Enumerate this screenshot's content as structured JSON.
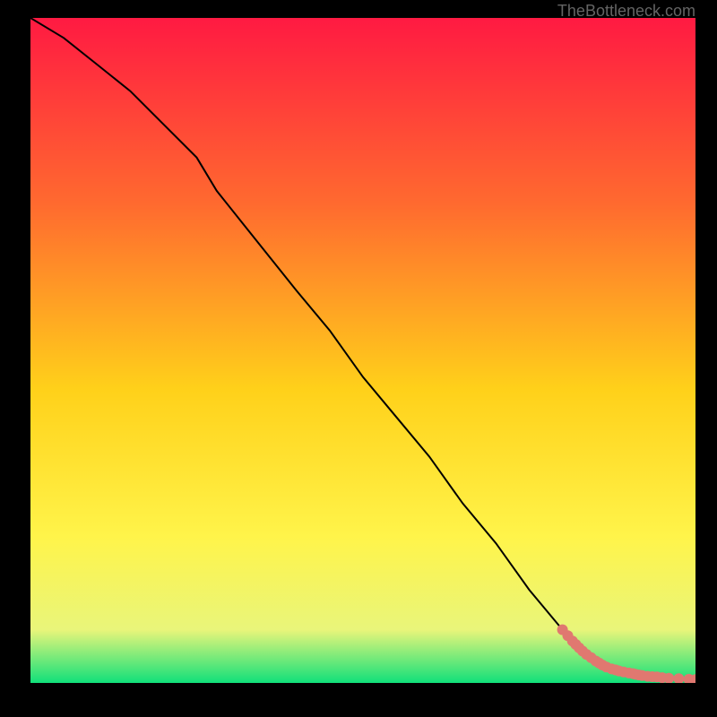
{
  "credit": "TheBottleneck.com",
  "colors": {
    "frame": "#000000",
    "gradient_top": "#ff1a42",
    "gradient_mid1": "#ff6a2f",
    "gradient_mid2": "#ffd11a",
    "gradient_mid3": "#fff44a",
    "gradient_low": "#e9f57a",
    "gradient_bottom": "#11e07a",
    "line": "#000000",
    "marker": "#e07870"
  },
  "chart_data": {
    "type": "line",
    "title": "",
    "xlabel": "",
    "ylabel": "",
    "xlim": [
      0,
      100
    ],
    "ylim": [
      0,
      100
    ],
    "series": [
      {
        "name": "curve",
        "x": [
          0,
          5,
          10,
          15,
          20,
          25,
          28,
          32,
          36,
          40,
          45,
          50,
          55,
          60,
          65,
          70,
          75,
          80,
          83,
          85,
          87,
          88,
          89,
          90,
          91,
          92,
          93,
          94,
          95,
          96,
          98,
          100
        ],
        "y": [
          100,
          97,
          93,
          89,
          84,
          79,
          74,
          69,
          64,
          59,
          53,
          46,
          40,
          34,
          27,
          21,
          14,
          8,
          4.5,
          3.3,
          2.4,
          2.0,
          1.7,
          1.5,
          1.3,
          1.1,
          1.0,
          0.9,
          0.8,
          0.7,
          0.6,
          0.5
        ]
      }
    ],
    "markers": {
      "name": "highlight-points",
      "x": [
        80,
        80.8,
        81.5,
        82,
        82.5,
        83,
        83.6,
        84.3,
        85,
        85.5,
        86,
        86.6,
        87.4,
        88,
        88.5,
        89.2,
        90,
        90.6,
        91,
        91.5,
        92,
        92.8,
        93.5,
        94.2,
        95,
        96,
        97.5,
        99,
        100
      ],
      "y": [
        8.0,
        7.1,
        6.3,
        5.8,
        5.3,
        4.8,
        4.3,
        3.8,
        3.3,
        3.0,
        2.7,
        2.4,
        2.1,
        1.95,
        1.8,
        1.65,
        1.5,
        1.4,
        1.3,
        1.2,
        1.1,
        1.0,
        0.95,
        0.9,
        0.8,
        0.7,
        0.65,
        0.55,
        0.5
      ]
    }
  }
}
